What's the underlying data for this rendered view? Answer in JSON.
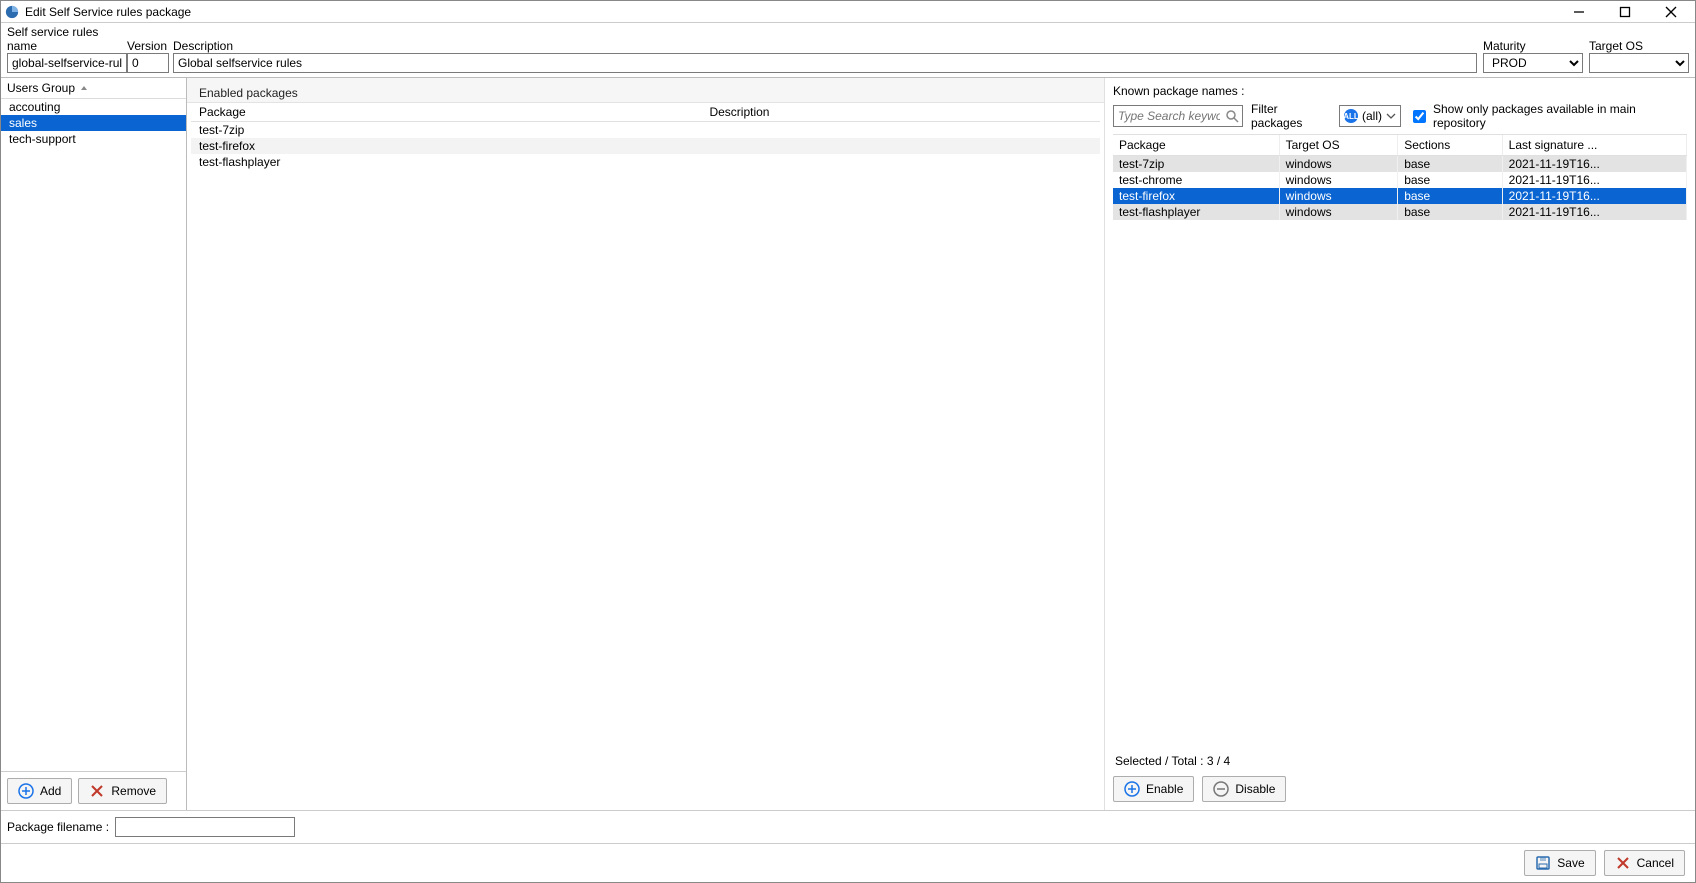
{
  "titlebar": {
    "title": "Edit Self Service rules package"
  },
  "header": {
    "name_label": "Self service rules name",
    "name_value": "global-selfservice-rules",
    "version_label": "Version",
    "version_value": "0",
    "description_label": "Description",
    "description_value": "Global selfservice rules",
    "maturity_label": "Maturity",
    "maturity_value": "PROD",
    "targetos_label": "Target OS",
    "targetos_value": ""
  },
  "left": {
    "header": "Users Group",
    "items": [
      "accouting",
      "sales",
      "tech-support"
    ],
    "selected_index": 1,
    "add_label": "Add",
    "remove_label": "Remove"
  },
  "center": {
    "title": "Enabled packages",
    "columns": [
      "Package",
      "Description"
    ],
    "rows": [
      {
        "package": "test-7zip",
        "description": ""
      },
      {
        "package": "test-firefox",
        "description": ""
      },
      {
        "package": "test-flashplayer",
        "description": ""
      }
    ]
  },
  "right": {
    "title": "Known package names :",
    "search_placeholder": "Type Search keywords",
    "filter_label": "Filter packages",
    "filter_value": "(all)",
    "show_repo_label": "Show only packages available in main repository",
    "show_repo_checked": true,
    "columns": [
      "Package",
      "Target OS",
      "Sections",
      "Last signature ..."
    ],
    "rows": [
      {
        "package": "test-7zip",
        "targetos": "windows",
        "sections": "base",
        "sig": "2021-11-19T16...",
        "enabled": true,
        "selected": false
      },
      {
        "package": "test-chrome",
        "targetos": "windows",
        "sections": "base",
        "sig": "2021-11-19T16...",
        "enabled": false,
        "selected": false
      },
      {
        "package": "test-firefox",
        "targetos": "windows",
        "sections": "base",
        "sig": "2021-11-19T16...",
        "enabled": true,
        "selected": true
      },
      {
        "package": "test-flashplayer",
        "targetos": "windows",
        "sections": "base",
        "sig": "2021-11-19T16...",
        "enabled": true,
        "selected": false
      }
    ],
    "footer": "Selected / Total : 3 / 4",
    "enable_label": "Enable",
    "disable_label": "Disable"
  },
  "bottom": {
    "pkg_filename_label": "Package filename :",
    "pkg_filename_value": ""
  },
  "footer": {
    "save_label": "Save",
    "cancel_label": "Cancel"
  }
}
